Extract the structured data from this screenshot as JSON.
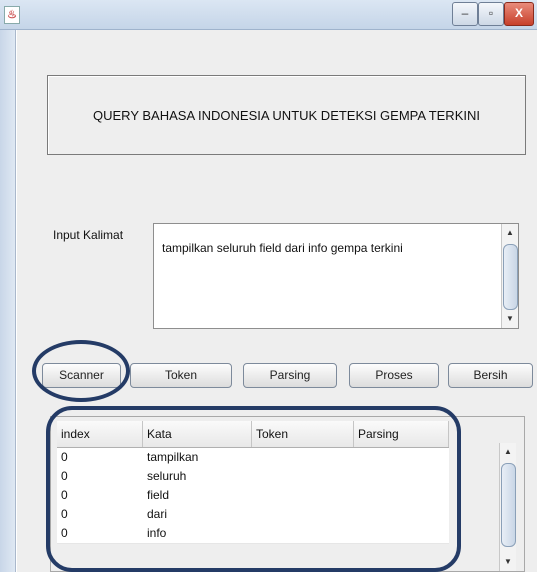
{
  "window": {
    "icon": "java-cup-icon",
    "controls": {
      "minimize": "–",
      "maximize": "▫",
      "close": "X"
    }
  },
  "header": {
    "title": "QUERY BAHASA INDONESIA UNTUK DETEKSI GEMPA TERKINI"
  },
  "input": {
    "label": "Input Kalimat",
    "value": "tampilkan seluruh field dari info gempa terkini"
  },
  "buttons": {
    "scanner": "Scanner",
    "token": "Token",
    "parsing": "Parsing",
    "proses": "Proses",
    "bersih": "Bersih"
  },
  "table": {
    "columns": [
      "index",
      "Kata",
      "Token",
      "Parsing"
    ],
    "rows": [
      {
        "index": "0",
        "kata": "tampilkan",
        "token": "",
        "parsing": ""
      },
      {
        "index": "0",
        "kata": "seluruh",
        "token": "",
        "parsing": ""
      },
      {
        "index": "0",
        "kata": "field",
        "token": "",
        "parsing": ""
      },
      {
        "index": "0",
        "kata": "dari",
        "token": "",
        "parsing": ""
      },
      {
        "index": "0",
        "kata": "info",
        "token": "",
        "parsing": ""
      }
    ]
  },
  "annotation_color": "#243b66"
}
